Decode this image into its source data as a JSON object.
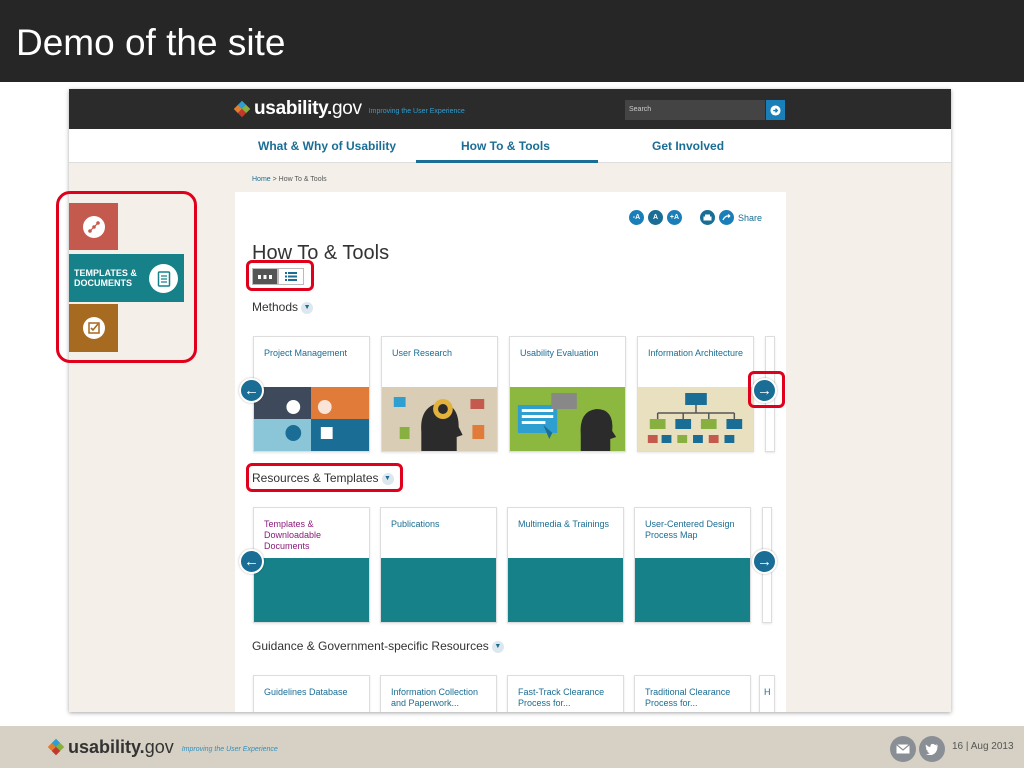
{
  "slide": {
    "title": "Demo of the site",
    "footer_logo_text": "usability.",
    "footer_logo_gov": "gov",
    "footer_tagline": "Improving the User Experience",
    "page_number": "16 | Aug 2013"
  },
  "site": {
    "logo_text": "usability.",
    "logo_gov": "gov",
    "tagline": "Improving the User Experience",
    "search_placeholder": "Search",
    "nav": [
      "What & Why of Usability",
      "How To & Tools",
      "Get Involved"
    ],
    "active_nav": "How To & Tools",
    "breadcrumb_home": "Home",
    "breadcrumb_current": " > How To & Tools",
    "left_panel": {
      "templates_label_1": "TEMPLATES &",
      "templates_label_2": "DOCUMENTS",
      "colors": [
        "#c45a4d",
        "#17818a",
        "#a66a21"
      ]
    },
    "toolbar": {
      "font_small": "-A",
      "font_normal": "A",
      "font_large": "+A",
      "share_label": "Share"
    },
    "page_heading": "How To & Tools",
    "sections": {
      "methods": "Methods",
      "resources": "Resources & Templates",
      "guidance": "Guidance & Government-specific Resources"
    },
    "methods_cards": [
      {
        "label": "Project Management"
      },
      {
        "label": "User Research"
      },
      {
        "label": "Usability Evaluation"
      },
      {
        "label": "Information Architecture"
      }
    ],
    "resources_cards": [
      {
        "label": "Templates & Downloadable Documents"
      },
      {
        "label": "Publications"
      },
      {
        "label": "Multimedia & Trainings"
      },
      {
        "label": "User-Centered Design Process Map"
      }
    ],
    "guidance_cards": [
      {
        "label": "Guidelines Database"
      },
      {
        "label": "Information Collection and Paperwork..."
      },
      {
        "label": "Fast-Track Clearance Process for..."
      },
      {
        "label": "Traditional Clearance Process for..."
      },
      {
        "label": "H"
      }
    ],
    "accent_color": "#1a6d94",
    "teal_color": "#17818a",
    "highlight_color": "#e0001b"
  }
}
